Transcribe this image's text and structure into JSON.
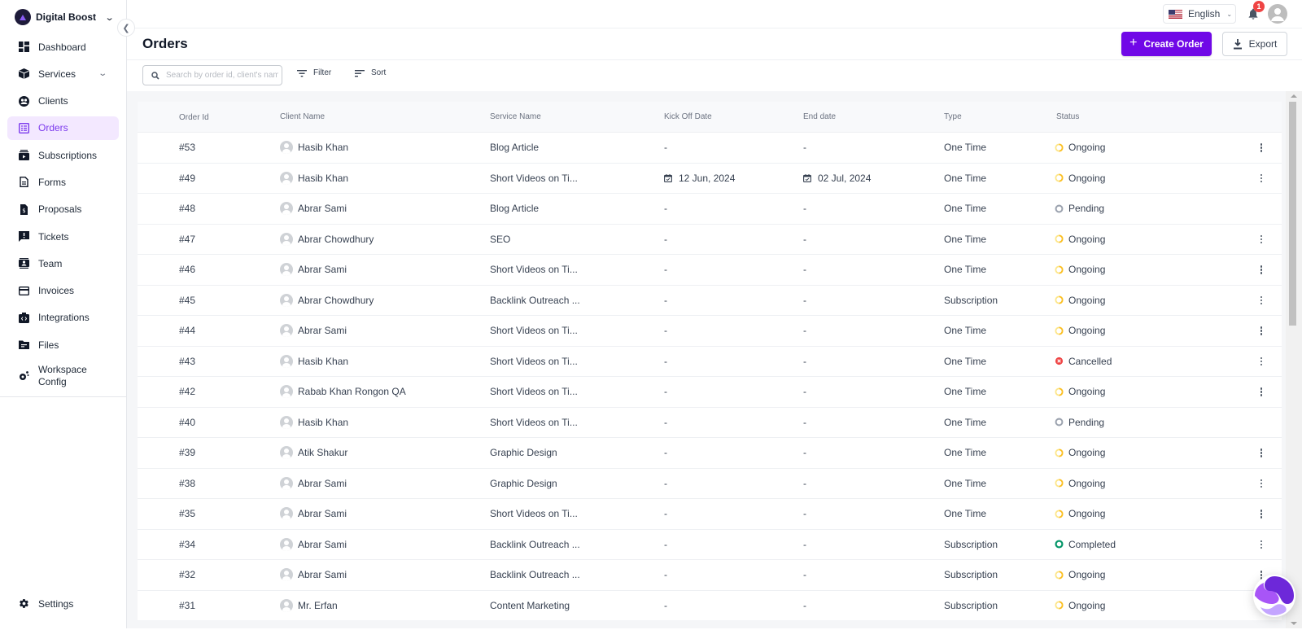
{
  "workspace": {
    "name": "Digital Boost"
  },
  "sidebar": {
    "items": [
      {
        "label": "Dashboard",
        "icon": "dashboard-icon"
      },
      {
        "label": "Services",
        "icon": "cube-icon",
        "expandable": true
      },
      {
        "label": "Clients",
        "icon": "clients-icon"
      },
      {
        "label": "Orders",
        "icon": "orders-icon",
        "active": true
      },
      {
        "label": "Subscriptions",
        "icon": "subscriptions-icon"
      },
      {
        "label": "Forms",
        "icon": "document-icon"
      },
      {
        "label": "Proposals",
        "icon": "proposal-icon"
      },
      {
        "label": "Tickets",
        "icon": "ticket-icon"
      },
      {
        "label": "Team",
        "icon": "team-icon"
      },
      {
        "label": "Invoices",
        "icon": "credit-card-icon"
      },
      {
        "label": "Integrations",
        "icon": "integrations-icon"
      },
      {
        "label": "Files",
        "icon": "folder-icon"
      },
      {
        "label": "Workspace Config",
        "icon": "gears-icon"
      }
    ],
    "settings_label": "Settings"
  },
  "topbar": {
    "language": "English",
    "notification_count": "1"
  },
  "header": {
    "title": "Orders",
    "create_label": "Create Order",
    "export_label": "Export"
  },
  "toolbar": {
    "search_placeholder": "Search by order id, client's name",
    "search_value": "",
    "filter_label": "Filter",
    "sort_label": "Sort"
  },
  "colors": {
    "accent": "#7008e7",
    "active_nav_bg": "#f3e8ff",
    "ongoing": "#fbbf24",
    "pending": "#9ca3af",
    "cancelled": "#ef4444",
    "completed": "#059669"
  },
  "table": {
    "columns": [
      "Order Id",
      "Client Name",
      "Service Name",
      "Kick Off Date",
      "End date",
      "Type",
      "Status"
    ],
    "rows": [
      {
        "id": "#53",
        "client": "Hasib Khan",
        "service": "Blog Article",
        "kickoff": "-",
        "end": "-",
        "type": "One Time",
        "status": "Ongoing",
        "menu": true
      },
      {
        "id": "#49",
        "client": "Hasib Khan",
        "service": "Short Videos on Ti...",
        "kickoff": "12 Jun, 2024",
        "end": "02 Jul, 2024",
        "type": "One Time",
        "status": "Ongoing",
        "menu": true
      },
      {
        "id": "#48",
        "client": "Abrar Sami",
        "service": "Blog Article",
        "kickoff": "-",
        "end": "-",
        "type": "One Time",
        "status": "Pending",
        "menu": false
      },
      {
        "id": "#47",
        "client": "Abrar Chowdhury",
        "service": "SEO",
        "kickoff": "-",
        "end": "-",
        "type": "One Time",
        "status": "Ongoing",
        "menu": true
      },
      {
        "id": "#46",
        "client": "Abrar Sami",
        "service": "Short Videos on Ti...",
        "kickoff": "-",
        "end": "-",
        "type": "One Time",
        "status": "Ongoing",
        "menu": true
      },
      {
        "id": "#45",
        "client": "Abrar Chowdhury",
        "service": "Backlink Outreach ...",
        "kickoff": "-",
        "end": "-",
        "type": "Subscription",
        "status": "Ongoing",
        "menu": true
      },
      {
        "id": "#44",
        "client": "Abrar Sami",
        "service": "Short Videos on Ti...",
        "kickoff": "-",
        "end": "-",
        "type": "One Time",
        "status": "Ongoing",
        "menu": true
      },
      {
        "id": "#43",
        "client": "Hasib Khan",
        "service": "Short Videos on Ti...",
        "kickoff": "-",
        "end": "-",
        "type": "One Time",
        "status": "Cancelled",
        "menu": true
      },
      {
        "id": "#42",
        "client": "Rabab Khan Rongon QA",
        "service": "Short Videos on Ti...",
        "kickoff": "-",
        "end": "-",
        "type": "One Time",
        "status": "Ongoing",
        "menu": true
      },
      {
        "id": "#40",
        "client": "Hasib Khan",
        "service": "Short Videos on Ti...",
        "kickoff": "-",
        "end": "-",
        "type": "One Time",
        "status": "Pending",
        "menu": false
      },
      {
        "id": "#39",
        "client": "Atik Shakur",
        "service": "Graphic Design",
        "kickoff": "-",
        "end": "-",
        "type": "One Time",
        "status": "Ongoing",
        "menu": true
      },
      {
        "id": "#38",
        "client": "Abrar Sami",
        "service": "Graphic Design",
        "kickoff": "-",
        "end": "-",
        "type": "One Time",
        "status": "Ongoing",
        "menu": true
      },
      {
        "id": "#35",
        "client": "Abrar Sami",
        "service": "Short Videos on Ti...",
        "kickoff": "-",
        "end": "-",
        "type": "One Time",
        "status": "Ongoing",
        "menu": true
      },
      {
        "id": "#34",
        "client": "Abrar Sami",
        "service": "Backlink Outreach ...",
        "kickoff": "-",
        "end": "-",
        "type": "Subscription",
        "status": "Completed",
        "menu": true
      },
      {
        "id": "#32",
        "client": "Abrar Sami",
        "service": "Backlink Outreach ...",
        "kickoff": "-",
        "end": "-",
        "type": "Subscription",
        "status": "Ongoing",
        "menu": true
      },
      {
        "id": "#31",
        "client": "Mr. Erfan",
        "service": "Content Marketing",
        "kickoff": "-",
        "end": "-",
        "type": "Subscription",
        "status": "Ongoing",
        "menu": false
      }
    ]
  }
}
